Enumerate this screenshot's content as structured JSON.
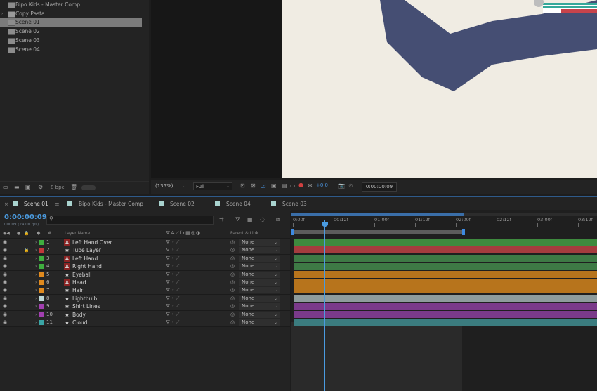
{
  "project": {
    "items": [
      {
        "label": "Bipo Kids - Master Comp",
        "type": "comp",
        "selected": false
      },
      {
        "label": "Copy Pasta",
        "type": "folder",
        "selected": false
      },
      {
        "label": "Scene 01",
        "type": "comp",
        "selected": true
      },
      {
        "label": "Scene 02",
        "type": "comp",
        "selected": false
      },
      {
        "label": "Scene 03",
        "type": "comp",
        "selected": false
      },
      {
        "label": "Scene 04",
        "type": "comp",
        "selected": false
      }
    ],
    "bpc": "8 bpc"
  },
  "viewer": {
    "zoom": "(135%)",
    "resolution": "Full",
    "exposure": "+0.0",
    "timecode": "0:00:00:09"
  },
  "tabs": [
    {
      "label": "Scene 01",
      "color": "#a9d3cf",
      "active": true
    },
    {
      "label": "Bipo Kids - Master Comp",
      "color": "#a9d3cf",
      "active": false
    },
    {
      "label": "Scene 02",
      "color": "#a9d3cf",
      "active": false
    },
    {
      "label": "Scene 04",
      "color": "#a9d3cf",
      "active": false
    },
    {
      "label": "Scene 03",
      "color": "#a9d3cf",
      "active": false
    }
  ],
  "timeline": {
    "current_time": "0:00:00:09",
    "fps_note": "00009 (24.00 fps)",
    "search_placeholder": "",
    "col_layer_name": "Layer Name",
    "col_parent": "Parent & Link",
    "col_hash": "#",
    "ruler": [
      "0:00f",
      "00:12f",
      "01:00f",
      "01:12f",
      "02:00f",
      "02:12f",
      "03:00f",
      "03:12f"
    ],
    "layers": [
      {
        "num": "1",
        "name": "Left Hand Over",
        "label_color": "#3fae3f",
        "icon": "puppet",
        "parent": "None",
        "bar_color": "#3e8a3e",
        "locked": false
      },
      {
        "num": "2",
        "name": "Tube Layer",
        "label_color": "#c2373b",
        "icon": "star",
        "parent": "None",
        "bar_color": "#a53c3e",
        "locked": true
      },
      {
        "num": "3",
        "name": "Left Hand",
        "label_color": "#3fae3f",
        "icon": "puppet",
        "parent": "None",
        "bar_color": "#3e7a45",
        "locked": false
      },
      {
        "num": "4",
        "name": "Right Hand",
        "label_color": "#3fae3f",
        "icon": "puppet",
        "parent": "None",
        "bar_color": "#3e7a45",
        "locked": false
      },
      {
        "num": "5",
        "name": "Eyeball",
        "label_color": "#e08a1e",
        "icon": "star",
        "parent": "None",
        "bar_color": "#b7741c",
        "locked": false
      },
      {
        "num": "6",
        "name": "Head",
        "label_color": "#e08a1e",
        "icon": "puppet",
        "parent": "None",
        "bar_color": "#b7741c",
        "locked": false
      },
      {
        "num": "7",
        "name": "Hair",
        "label_color": "#e08a1e",
        "icon": "star",
        "parent": "None",
        "bar_color": "#b7741c",
        "locked": false
      },
      {
        "num": "8",
        "name": "Lightbulb",
        "label_color": "#bcd7d7",
        "icon": "star",
        "parent": "None",
        "bar_color": "#8e9c9c",
        "locked": false
      },
      {
        "num": "9",
        "name": "Shirt Lines",
        "label_color": "#a23fb0",
        "icon": "star",
        "parent": "None",
        "bar_color": "#7a3a8a",
        "locked": false
      },
      {
        "num": "10",
        "name": "Body",
        "label_color": "#a23fb0",
        "icon": "star",
        "parent": "None",
        "bar_color": "#7a3a8a",
        "locked": false
      },
      {
        "num": "11",
        "name": "Cloud",
        "label_color": "#3aa5a5",
        "icon": "star",
        "parent": "None",
        "bar_color": "#3b7c7f",
        "locked": false
      }
    ]
  }
}
